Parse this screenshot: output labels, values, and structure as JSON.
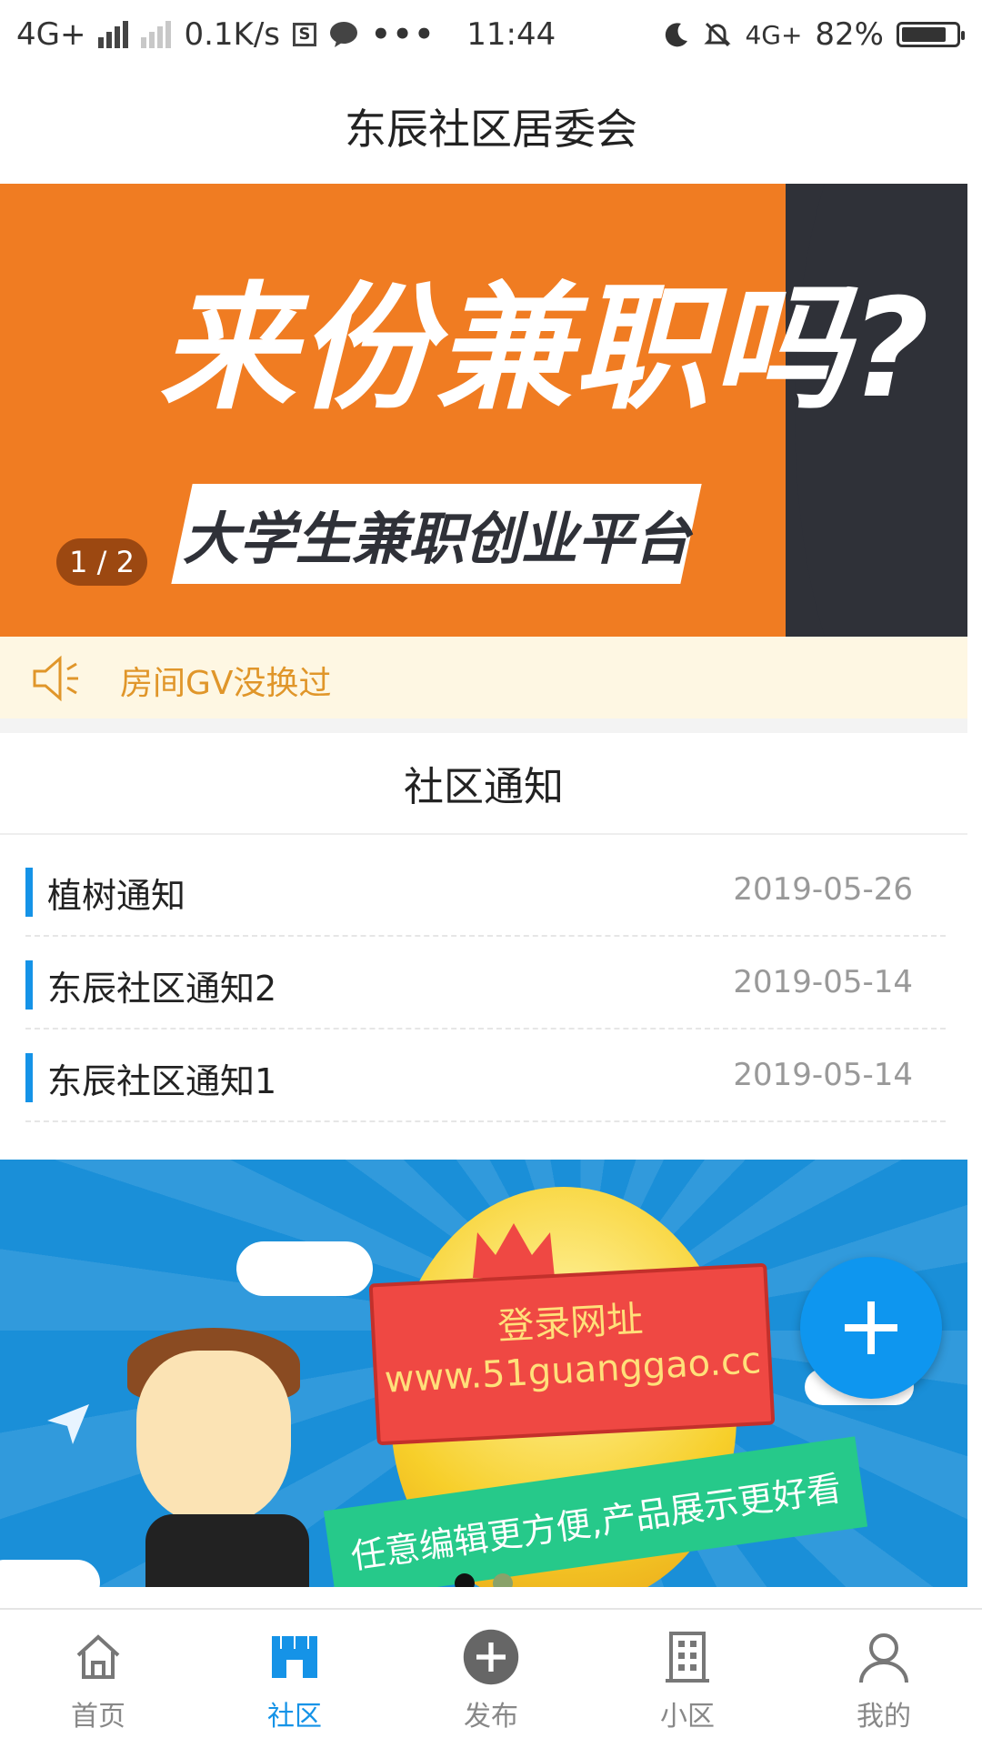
{
  "status_bar": {
    "network_left": "4G+",
    "speed": "0.1K/s",
    "time": "11:44",
    "network_right": "4G+",
    "battery": "82%",
    "battery_level": 0.82
  },
  "header": {
    "title": "东辰社区居委会"
  },
  "banner_top": {
    "headline": "来份兼职吗?",
    "subline": "大学生兼职创业平台",
    "pager": "1 / 2",
    "colors": {
      "orange": "#f07c22",
      "dark": "#2f3138"
    }
  },
  "notice_bar": {
    "text": "房间GV没换过",
    "icon": "speaker-icon"
  },
  "community": {
    "title": "社区通知",
    "items": [
      {
        "title": "植树通知",
        "date": "2019-05-26"
      },
      {
        "title": "东辰社区通知2",
        "date": "2019-05-14"
      },
      {
        "title": "东辰社区通知1",
        "date": "2019-05-14"
      }
    ]
  },
  "banner_ad": {
    "sign_line1": "登录网址",
    "sign_line2": "www.51guanggao.cc",
    "ribbon": "任意编辑更方便,产品展示更好看",
    "active_dot": 0
  },
  "fab": {
    "icon": "plus-icon"
  },
  "bottom_nav": {
    "items": [
      {
        "label": "首页",
        "icon": "home-icon"
      },
      {
        "label": "社区",
        "icon": "store-icon",
        "active": true
      },
      {
        "label": "发布",
        "icon": "plus-circle-icon"
      },
      {
        "label": "小区",
        "icon": "building-icon"
      },
      {
        "label": "我的",
        "icon": "user-icon"
      }
    ],
    "accent": "#1593e7"
  }
}
